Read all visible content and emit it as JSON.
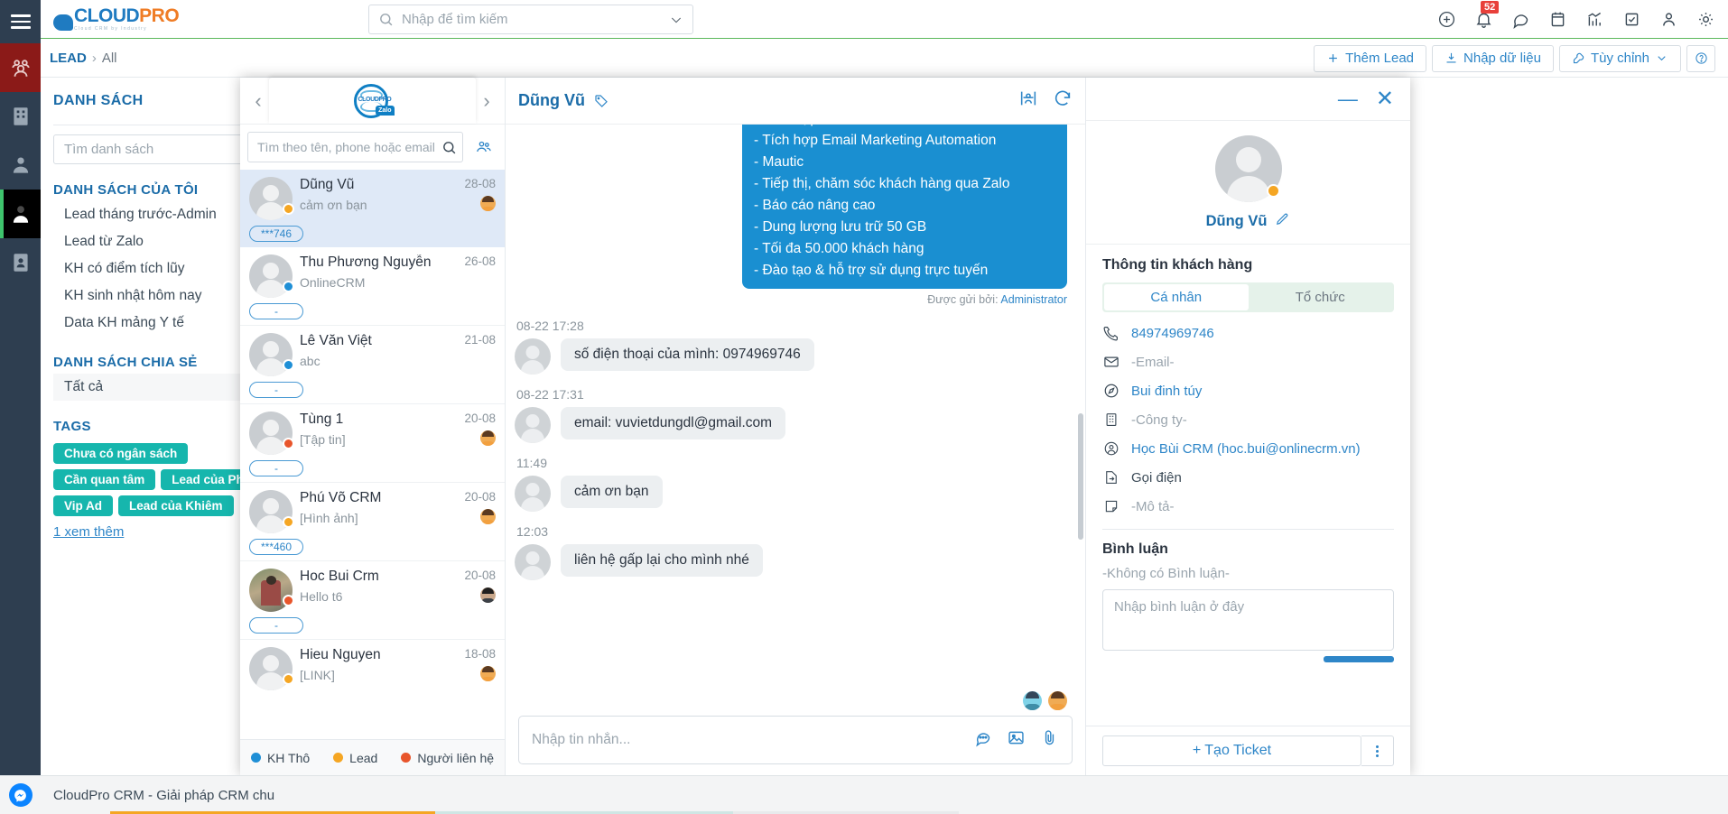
{
  "brand": {
    "name_blue": "CLOUD",
    "name_orange": "PRO",
    "tagline": "Cloud CRM by Industry",
    "accent": "#1f7bc1",
    "accent2": "#ef7c25"
  },
  "topbar": {
    "search_placeholder": "Nhập để tìm kiếm",
    "notification_count": "52",
    "icons": [
      "plus-circle-icon",
      "bell-icon",
      "chat-icon",
      "calendar-icon",
      "analytics-icon",
      "task-icon",
      "user-icon",
      "gear-icon"
    ]
  },
  "breadcrumb": {
    "module": "LEAD",
    "separator": "›",
    "current": "All"
  },
  "page_actions": {
    "add_lead": "Thêm Lead",
    "import": "Nhập dữ liệu",
    "customize": "Tùy chỉnh",
    "help": "?"
  },
  "list_panel": {
    "title": "DANH SÁCH",
    "add_label": "+",
    "search_placeholder": "Tìm danh sách",
    "my_lists_header": "DANH SÁCH CỦA TÔI",
    "my_lists": [
      "Lead tháng trước-Admin",
      "Lead từ Zalo",
      "KH có điểm tích lũy",
      "KH sinh nhật hôm nay",
      "Data KH mảng Y tế"
    ],
    "shared_header": "DANH SÁCH CHIA SẺ",
    "shared": [
      "Tất cả"
    ],
    "tags_header": "TAGS",
    "tags": [
      "Chưa có ngân sách",
      "Cần quan tâm",
      "Lead của Phi",
      "Vip Ad",
      "Lead của Khiêm"
    ],
    "more_link": "1  xem thêm"
  },
  "zalo": {
    "contacts_search_placeholder": "Tìm theo tên, phone hoặc email",
    "contacts": [
      {
        "name": "Dũng Vũ",
        "preview": "cảm ơn bạn",
        "date": "28-08",
        "status_color": "#f5a623",
        "pill": "***746",
        "has_agent": true,
        "agent_style": "light",
        "avatar": "default",
        "active": true
      },
      {
        "name": "Thu Phương Nguyễn",
        "preview": "OnlineCRM",
        "date": "26-08",
        "status_color": "#1f8fd6",
        "pill": "-",
        "has_agent": false,
        "agent_style": "light",
        "avatar": "default",
        "active": false
      },
      {
        "name": "Lê Văn Việt",
        "preview": "abc",
        "date": "21-08",
        "status_color": "#1f8fd6",
        "pill": "-",
        "has_agent": false,
        "agent_style": "light",
        "avatar": "default",
        "active": false
      },
      {
        "name": "Tùng 1",
        "preview": "[Tập tin]",
        "date": "20-08",
        "status_color": "#e8552b",
        "pill": "-",
        "has_agent": true,
        "agent_style": "light",
        "avatar": "default",
        "active": false
      },
      {
        "name": "Phú Võ CRM",
        "preview": "[Hình ảnh]",
        "date": "20-08",
        "status_color": "#f5a623",
        "pill": "***460",
        "has_agent": true,
        "agent_style": "light",
        "avatar": "default",
        "active": false
      },
      {
        "name": "Hoc Bui Crm",
        "preview": "Hello t6",
        "date": "20-08",
        "status_color": "#e8552b",
        "pill": "-",
        "has_agent": true,
        "agent_style": "dark",
        "avatar": "photo",
        "active": false
      },
      {
        "name": "Hieu Nguyen",
        "preview": "[LINK]",
        "date": "18-08",
        "status_color": "#f5a623",
        "pill": "",
        "has_agent": true,
        "agent_style": "light",
        "avatar": "default",
        "active": false
      }
    ],
    "legend": [
      {
        "label": "KH Thô",
        "color": "#1f8fd6"
      },
      {
        "label": "Lead",
        "color": "#f5a623"
      },
      {
        "label": "Người liên hệ",
        "color": "#e8552b"
      }
    ],
    "chat": {
      "header_name": "Dũng Vũ",
      "outgoing_bubble": "- Tích hợp Zalo Official Account\n- Tích hợp Email Marketing Automation\n- Mautic\n- Tiếp thị, chăm sóc khách hàng qua Zalo\n- Báo cáo nâng cao\n- Dung lượng lưu trữ 50 GB\n- Tối đa 50.000 khách hàng\n- Đào tạo & hỗ trợ sử dụng trực tuyến",
      "sent_by_label": "Được gửi bởi:",
      "sent_by_name": "Administrator",
      "messages": [
        {
          "time": "08-22 17:28",
          "text": "số điện thoại của mình: 0974969746"
        },
        {
          "time": "08-22 17:31",
          "text": "email: vuvietdungdl@gmail.com"
        },
        {
          "time": "11:49",
          "text": "cảm ơn bạn"
        },
        {
          "time": "12:03",
          "text": "liên hệ gấp lại cho mình nhé"
        }
      ],
      "input_placeholder": "Nhập tin nhắn...",
      "input_tools": [
        "quick-reply-icon",
        "image-icon",
        "attachment-icon"
      ]
    },
    "info": {
      "profile_name": "Dũng Vũ",
      "section_title": "Thông tin khách hàng",
      "tab_personal": "Cá nhân",
      "tab_org": "Tổ chức",
      "fields": [
        {
          "icon": "phone-icon",
          "value": "84974969746",
          "style": "link"
        },
        {
          "icon": "mail-icon",
          "value": "-Email-",
          "style": "dim"
        },
        {
          "icon": "compass-icon",
          "value": "Bui đinh túy",
          "style": "link"
        },
        {
          "icon": "building-icon",
          "value": "-Công ty-",
          "style": "dim"
        },
        {
          "icon": "account-icon",
          "value": "Học Bùi CRM (hoc.bui@onlinecrm.vn)",
          "style": "link"
        },
        {
          "icon": "call-out-icon",
          "value": "Gọi điện",
          "style": "plain"
        },
        {
          "icon": "note-icon",
          "value": "-Mô tả-",
          "style": "dim"
        }
      ],
      "comments_title": "Bình luận",
      "comments_empty": "-Không có Bình luận-",
      "comment_placeholder": "Nhập bình luận ở đây",
      "create_ticket": "Tạo Ticket"
    }
  },
  "taskbar": {
    "window_title": "CloudPro CRM - Giải pháp CRM chu"
  }
}
